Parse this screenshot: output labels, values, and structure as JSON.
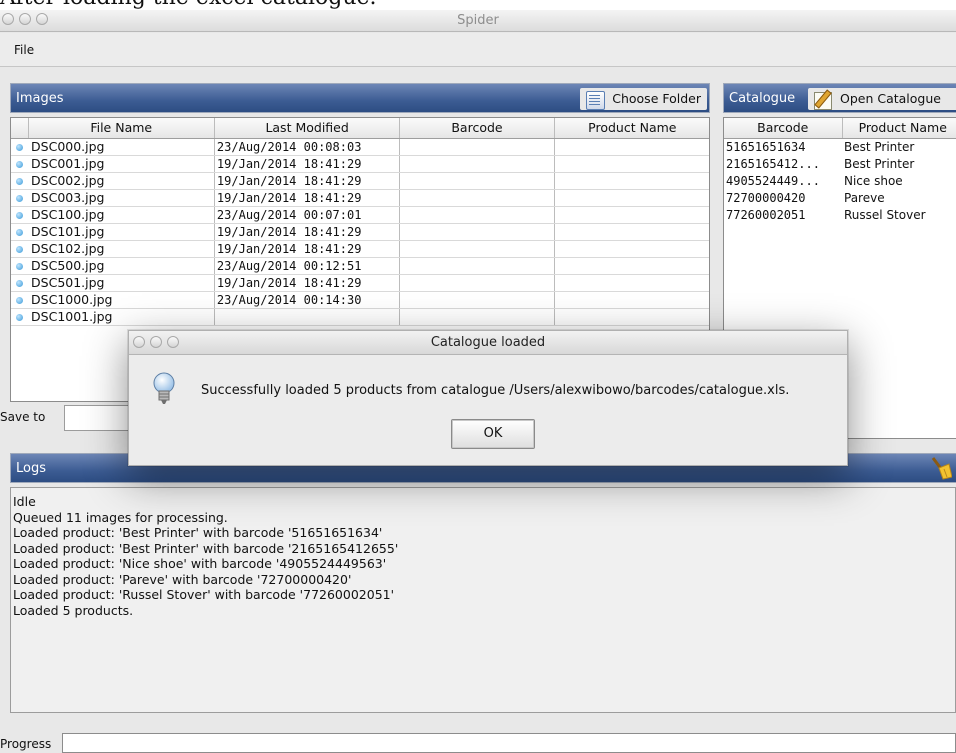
{
  "caption": "After loading the excel catalogue.",
  "window": {
    "title": "Spider"
  },
  "menu": {
    "file_label": "File"
  },
  "images_panel": {
    "title": "Images",
    "choose_folder_label": "Choose Folder",
    "columns": [
      "File Name",
      "Last Modified",
      "Barcode",
      "Product Name"
    ],
    "rows": [
      {
        "file": "DSC000.jpg",
        "modified": "23/Aug/2014 00:08:03",
        "barcode": "",
        "product": ""
      },
      {
        "file": "DSC001.jpg",
        "modified": "19/Jan/2014 18:41:29",
        "barcode": "",
        "product": ""
      },
      {
        "file": "DSC002.jpg",
        "modified": "19/Jan/2014 18:41:29",
        "barcode": "",
        "product": ""
      },
      {
        "file": "DSC003.jpg",
        "modified": "19/Jan/2014 18:41:29",
        "barcode": "",
        "product": ""
      },
      {
        "file": "DSC100.jpg",
        "modified": "23/Aug/2014 00:07:01",
        "barcode": "",
        "product": ""
      },
      {
        "file": "DSC101.jpg",
        "modified": "19/Jan/2014 18:41:29",
        "barcode": "",
        "product": ""
      },
      {
        "file": "DSC102.jpg",
        "modified": "19/Jan/2014 18:41:29",
        "barcode": "",
        "product": ""
      },
      {
        "file": "DSC500.jpg",
        "modified": "23/Aug/2014 00:12:51",
        "barcode": "",
        "product": ""
      },
      {
        "file": "DSC501.jpg",
        "modified": "19/Jan/2014 18:41:29",
        "barcode": "",
        "product": ""
      },
      {
        "file": "DSC1000.jpg",
        "modified": "23/Aug/2014 00:14:30",
        "barcode": "",
        "product": ""
      },
      {
        "file": "DSC1001.jpg",
        "modified": "",
        "barcode": "",
        "product": ""
      }
    ]
  },
  "catalogue_panel": {
    "title": "Catalogue",
    "open_label": "Open Catalogue",
    "columns": [
      "Barcode",
      "Product Name"
    ],
    "rows": [
      {
        "barcode": "51651651634",
        "product": "Best Printer"
      },
      {
        "barcode": "2165165412...",
        "product": "Best Printer"
      },
      {
        "barcode": "4905524449...",
        "product": "Nice shoe"
      },
      {
        "barcode": "72700000420",
        "product": "Pareve"
      },
      {
        "barcode": "77260002051",
        "product": "Russel Stover"
      }
    ]
  },
  "save_to_label": "Save to",
  "logs_panel": {
    "title": "Logs",
    "lines": [
      "Idle",
      "Queued 11 images for processing.",
      "Loaded product: 'Best Printer' with barcode '51651651634'",
      "Loaded product: 'Best Printer' with barcode '2165165412655'",
      "Loaded product: 'Nice shoe' with barcode '4905524449563'",
      "Loaded product: 'Pareve' with barcode '72700000420'",
      "Loaded product: 'Russel Stover' with barcode '77260002051'",
      "Loaded 5 products."
    ]
  },
  "progress_label": "Progress",
  "dialog": {
    "title": "Catalogue loaded",
    "message": "Successfully loaded 5 products from catalogue /Users/alexwibowo/barcodes/catalogue.xls.",
    "ok_label": "OK"
  },
  "icons": {
    "choose_folder": "folder-icon",
    "open_catalogue": "notepad-icon",
    "clear_logs": "broom-icon",
    "dialog": "lightbulb-icon"
  }
}
